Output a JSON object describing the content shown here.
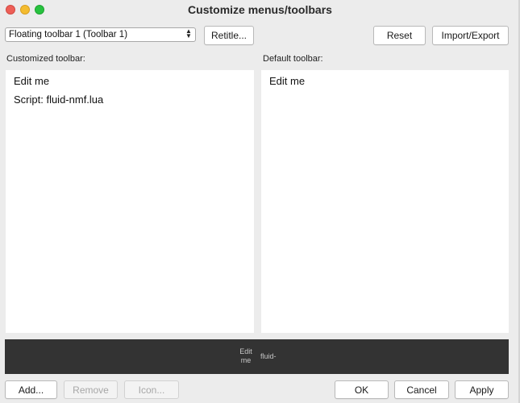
{
  "window": {
    "title": "Customize menus/toolbars"
  },
  "toolbar_select": {
    "value": "Floating toolbar 1 (Toolbar 1)"
  },
  "buttons": {
    "retitle": "Retitle...",
    "reset": "Reset",
    "import_export": "Import/Export",
    "add": "Add...",
    "remove": "Remove",
    "icon": "Icon...",
    "ok": "OK",
    "cancel": "Cancel",
    "apply": "Apply"
  },
  "customized": {
    "label": "Customized toolbar:",
    "items": [
      "Edit me",
      "Script: fluid-nmf.lua"
    ]
  },
  "default": {
    "label": "Default toolbar:",
    "items": [
      "Edit me"
    ]
  },
  "preview": {
    "items": [
      "Edit me",
      "fluid-"
    ]
  },
  "colors": {
    "window_bg": "#ececec",
    "preview_bg": "#333333",
    "close": "#ee5f57",
    "minimize": "#f4bc2f",
    "maximize": "#27c23f"
  }
}
